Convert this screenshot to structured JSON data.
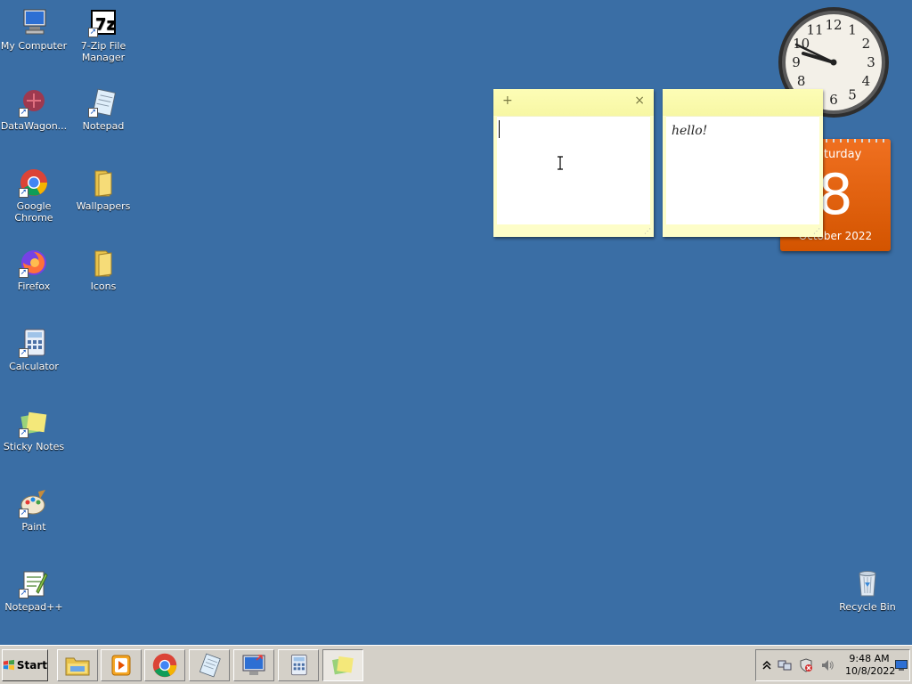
{
  "desktop": {
    "icons": [
      {
        "label": "My Computer",
        "icon": "my-computer-icon"
      },
      {
        "label": "7-Zip File Manager",
        "icon": "seven-zip-icon"
      },
      {
        "label": "DataWagon...",
        "icon": "datawagon-icon"
      },
      {
        "label": "Notepad",
        "icon": "notepad-icon"
      },
      {
        "label": "Google Chrome",
        "icon": "chrome-icon"
      },
      {
        "label": "Wallpapers",
        "icon": "folder-icon"
      },
      {
        "label": "Firefox",
        "icon": "firefox-icon"
      },
      {
        "label": "Icons",
        "icon": "folder-icon"
      },
      {
        "label": "Calculator",
        "icon": "calculator-icon"
      },
      {
        "label": "Sticky Notes",
        "icon": "sticky-notes-icon"
      },
      {
        "label": "Paint",
        "icon": "paint-icon"
      },
      {
        "label": "Notepad++",
        "icon": "notepad-plus-plus-icon"
      },
      {
        "label": "Recycle Bin",
        "icon": "recycle-bin-icon"
      }
    ]
  },
  "clock_gadget": {
    "numerals": [
      "12",
      "1",
      "2",
      "3",
      "4",
      "5",
      "6",
      "7",
      "8",
      "9",
      "10",
      "11"
    ],
    "time": "9:48"
  },
  "calendar_gadget": {
    "day": "Saturday",
    "date": "8",
    "month": "October 2022",
    "color": "#e8671c"
  },
  "sticky_notes": [
    {
      "text": "",
      "add_symbol": "+",
      "close_symbol": "×"
    },
    {
      "text": "hello!"
    }
  ],
  "taskbar": {
    "start_label": "Start",
    "buttons": [
      {
        "icon": "file-explorer-icon"
      },
      {
        "icon": "media-player-icon"
      },
      {
        "icon": "chrome-icon"
      },
      {
        "icon": "notepad-icon"
      },
      {
        "icon": "remote-desktop-icon"
      },
      {
        "icon": "calculator-icon"
      },
      {
        "icon": "sticky-notes-icon",
        "active": true
      }
    ],
    "tray": {
      "icons": [
        "tray-expand-icon",
        "network-icon",
        "security-alert-icon",
        "volume-icon"
      ],
      "time": "9:48 AM",
      "date": "10/8/2022"
    }
  },
  "colors": {
    "desktop_bg": "#3a6ea5",
    "note_bg": "#fdfdc8",
    "taskbar_bg": "#d4d0c8"
  }
}
